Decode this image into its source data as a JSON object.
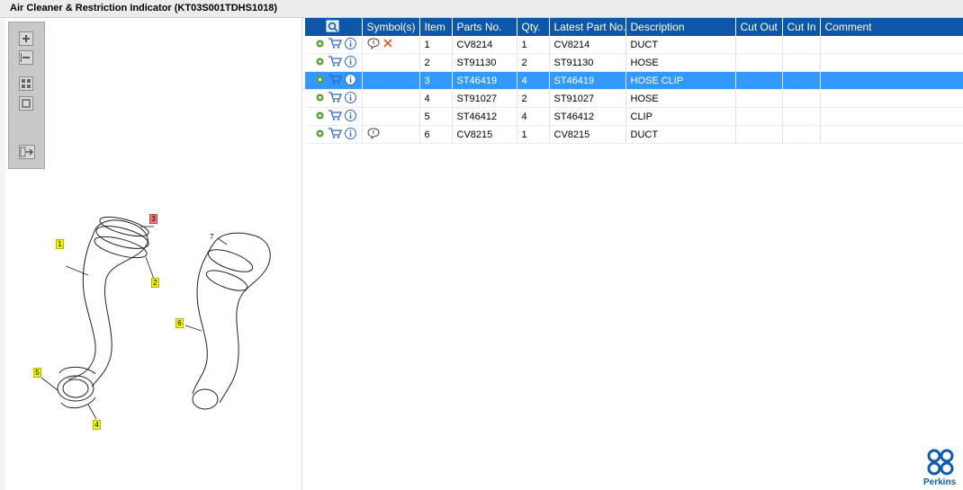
{
  "window": {
    "title": "Air Cleaner & Restriction Indicator (KT03S001TDHS1018)"
  },
  "toolbar": {
    "zoom_in": "zoom-in",
    "zoom_out": "zoom-out",
    "fit_all": "fit-all",
    "fit_window": "fit-window",
    "export": "export"
  },
  "table": {
    "columns": [
      "",
      "Symbol(s)",
      "Item",
      "Parts No.",
      "Qty.",
      "Latest Part No.",
      "Description",
      "Cut Out",
      "Cut In",
      "Comment"
    ],
    "rows": [
      {
        "item": "1",
        "part": "CV8214",
        "qty": "1",
        "latest": "CV8214",
        "desc": "DUCT",
        "cut_out": "",
        "cut_in": "",
        "comment": "",
        "symbols": [
          "comment-icon",
          "remove-icon"
        ]
      },
      {
        "item": "2",
        "part": "ST91130",
        "qty": "2",
        "latest": "ST91130",
        "desc": "HOSE",
        "cut_out": "",
        "cut_in": "",
        "comment": "",
        "symbols": []
      },
      {
        "item": "3",
        "part": "ST46419",
        "qty": "4",
        "latest": "ST46419",
        "desc": "HOSE CLIP",
        "cut_out": "",
        "cut_in": "",
        "comment": "",
        "symbols": [],
        "selected": true
      },
      {
        "item": "4",
        "part": "ST91027",
        "qty": "2",
        "latest": "ST91027",
        "desc": "HOSE",
        "cut_out": "",
        "cut_in": "",
        "comment": "",
        "symbols": []
      },
      {
        "item": "5",
        "part": "ST46412",
        "qty": "4",
        "latest": "ST46412",
        "desc": "CLIP",
        "cut_out": "",
        "cut_in": "",
        "comment": "",
        "symbols": []
      },
      {
        "item": "6",
        "part": "CV8215",
        "qty": "1",
        "latest": "CV8215",
        "desc": "DUCT",
        "cut_out": "",
        "cut_in": "",
        "comment": "",
        "symbols": [
          "comment-icon"
        ]
      }
    ]
  },
  "diagram": {
    "callouts": [
      "1",
      "2",
      "3",
      "4",
      "5",
      "6",
      "7"
    ],
    "highlighted": "3"
  },
  "brand": {
    "name": "Perkins",
    "color": "#0e5cad"
  },
  "colors": {
    "header": "#0d56a8",
    "selected_row": "#3399ff",
    "gear": "#5aa02c",
    "cart": "#2a6ac2",
    "info": "#2a6ac2",
    "remove": "#e05b1a"
  }
}
